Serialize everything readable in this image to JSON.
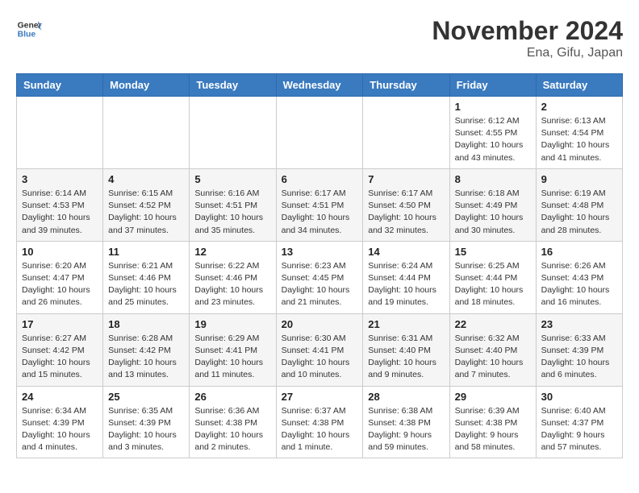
{
  "header": {
    "logo_general": "General",
    "logo_blue": "Blue",
    "month_title": "November 2024",
    "location": "Ena, Gifu, Japan"
  },
  "days_of_week": [
    "Sunday",
    "Monday",
    "Tuesday",
    "Wednesday",
    "Thursday",
    "Friday",
    "Saturday"
  ],
  "weeks": [
    [
      {
        "day": "",
        "info": ""
      },
      {
        "day": "",
        "info": ""
      },
      {
        "day": "",
        "info": ""
      },
      {
        "day": "",
        "info": ""
      },
      {
        "day": "",
        "info": ""
      },
      {
        "day": "1",
        "info": "Sunrise: 6:12 AM\nSunset: 4:55 PM\nDaylight: 10 hours\nand 43 minutes."
      },
      {
        "day": "2",
        "info": "Sunrise: 6:13 AM\nSunset: 4:54 PM\nDaylight: 10 hours\nand 41 minutes."
      }
    ],
    [
      {
        "day": "3",
        "info": "Sunrise: 6:14 AM\nSunset: 4:53 PM\nDaylight: 10 hours\nand 39 minutes."
      },
      {
        "day": "4",
        "info": "Sunrise: 6:15 AM\nSunset: 4:52 PM\nDaylight: 10 hours\nand 37 minutes."
      },
      {
        "day": "5",
        "info": "Sunrise: 6:16 AM\nSunset: 4:51 PM\nDaylight: 10 hours\nand 35 minutes."
      },
      {
        "day": "6",
        "info": "Sunrise: 6:17 AM\nSunset: 4:51 PM\nDaylight: 10 hours\nand 34 minutes."
      },
      {
        "day": "7",
        "info": "Sunrise: 6:17 AM\nSunset: 4:50 PM\nDaylight: 10 hours\nand 32 minutes."
      },
      {
        "day": "8",
        "info": "Sunrise: 6:18 AM\nSunset: 4:49 PM\nDaylight: 10 hours\nand 30 minutes."
      },
      {
        "day": "9",
        "info": "Sunrise: 6:19 AM\nSunset: 4:48 PM\nDaylight: 10 hours\nand 28 minutes."
      }
    ],
    [
      {
        "day": "10",
        "info": "Sunrise: 6:20 AM\nSunset: 4:47 PM\nDaylight: 10 hours\nand 26 minutes."
      },
      {
        "day": "11",
        "info": "Sunrise: 6:21 AM\nSunset: 4:46 PM\nDaylight: 10 hours\nand 25 minutes."
      },
      {
        "day": "12",
        "info": "Sunrise: 6:22 AM\nSunset: 4:46 PM\nDaylight: 10 hours\nand 23 minutes."
      },
      {
        "day": "13",
        "info": "Sunrise: 6:23 AM\nSunset: 4:45 PM\nDaylight: 10 hours\nand 21 minutes."
      },
      {
        "day": "14",
        "info": "Sunrise: 6:24 AM\nSunset: 4:44 PM\nDaylight: 10 hours\nand 19 minutes."
      },
      {
        "day": "15",
        "info": "Sunrise: 6:25 AM\nSunset: 4:44 PM\nDaylight: 10 hours\nand 18 minutes."
      },
      {
        "day": "16",
        "info": "Sunrise: 6:26 AM\nSunset: 4:43 PM\nDaylight: 10 hours\nand 16 minutes."
      }
    ],
    [
      {
        "day": "17",
        "info": "Sunrise: 6:27 AM\nSunset: 4:42 PM\nDaylight: 10 hours\nand 15 minutes."
      },
      {
        "day": "18",
        "info": "Sunrise: 6:28 AM\nSunset: 4:42 PM\nDaylight: 10 hours\nand 13 minutes."
      },
      {
        "day": "19",
        "info": "Sunrise: 6:29 AM\nSunset: 4:41 PM\nDaylight: 10 hours\nand 11 minutes."
      },
      {
        "day": "20",
        "info": "Sunrise: 6:30 AM\nSunset: 4:41 PM\nDaylight: 10 hours\nand 10 minutes."
      },
      {
        "day": "21",
        "info": "Sunrise: 6:31 AM\nSunset: 4:40 PM\nDaylight: 10 hours\nand 9 minutes."
      },
      {
        "day": "22",
        "info": "Sunrise: 6:32 AM\nSunset: 4:40 PM\nDaylight: 10 hours\nand 7 minutes."
      },
      {
        "day": "23",
        "info": "Sunrise: 6:33 AM\nSunset: 4:39 PM\nDaylight: 10 hours\nand 6 minutes."
      }
    ],
    [
      {
        "day": "24",
        "info": "Sunrise: 6:34 AM\nSunset: 4:39 PM\nDaylight: 10 hours\nand 4 minutes."
      },
      {
        "day": "25",
        "info": "Sunrise: 6:35 AM\nSunset: 4:39 PM\nDaylight: 10 hours\nand 3 minutes."
      },
      {
        "day": "26",
        "info": "Sunrise: 6:36 AM\nSunset: 4:38 PM\nDaylight: 10 hours\nand 2 minutes."
      },
      {
        "day": "27",
        "info": "Sunrise: 6:37 AM\nSunset: 4:38 PM\nDaylight: 10 hours\nand 1 minute."
      },
      {
        "day": "28",
        "info": "Sunrise: 6:38 AM\nSunset: 4:38 PM\nDaylight: 9 hours\nand 59 minutes."
      },
      {
        "day": "29",
        "info": "Sunrise: 6:39 AM\nSunset: 4:38 PM\nDaylight: 9 hours\nand 58 minutes."
      },
      {
        "day": "30",
        "info": "Sunrise: 6:40 AM\nSunset: 4:37 PM\nDaylight: 9 hours\nand 57 minutes."
      }
    ]
  ]
}
